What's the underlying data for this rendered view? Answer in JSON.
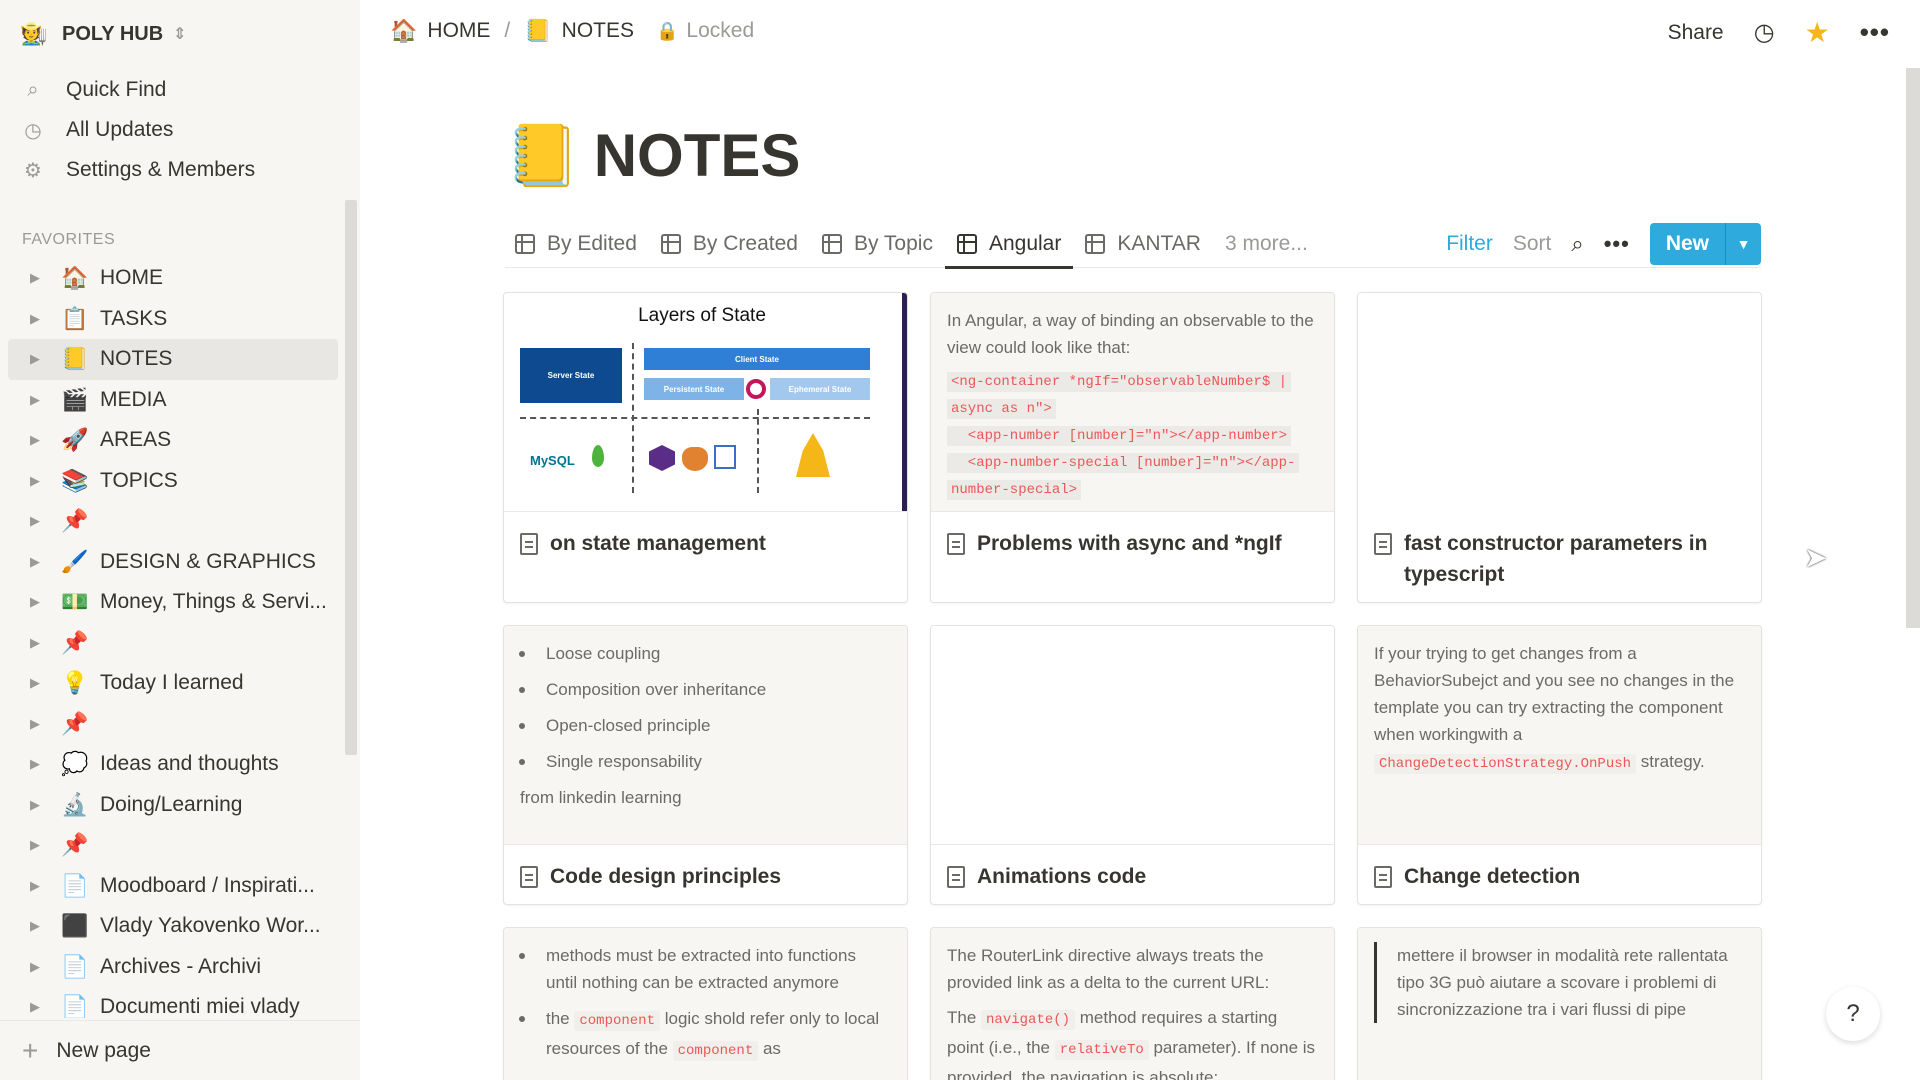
{
  "sidebar": {
    "workspace": {
      "emoji": "🧑‍🌾",
      "name": "POLY HUB"
    },
    "nav": [
      {
        "icon": "search-icon",
        "glyph": "⚲",
        "label": "Quick Find"
      },
      {
        "icon": "clock-icon",
        "glyph": "◷",
        "label": "All Updates"
      },
      {
        "icon": "gear-icon",
        "glyph": "⚙",
        "label": "Settings & Members"
      }
    ],
    "favorites_label": "FAVORITES",
    "favorites": [
      {
        "emoji": "🏠",
        "label": "HOME"
      },
      {
        "emoji": "📋",
        "label": "TASKS"
      },
      {
        "emoji": "📒",
        "label": "NOTES"
      },
      {
        "emoji": "🎬",
        "label": "MEDIA"
      },
      {
        "emoji": "🚀",
        "label": "AREAS"
      },
      {
        "emoji": "📚",
        "label": "TOPICS"
      },
      {
        "emoji": "📌",
        "label": ""
      },
      {
        "emoji": "🖌️",
        "label": "DESIGN & GRAPHICS"
      },
      {
        "emoji": "💵",
        "label": "Money, Things & Servi..."
      },
      {
        "emoji": "📌",
        "label": ""
      },
      {
        "emoji": "💡",
        "label": "Today I learned"
      },
      {
        "emoji": "📌",
        "label": ""
      },
      {
        "emoji": "💭",
        "label": "Ideas and thoughts"
      },
      {
        "emoji": "🔬",
        "label": "Doing/Learning"
      },
      {
        "emoji": "📌",
        "label": ""
      },
      {
        "emoji": "📄",
        "label": "Moodboard / Inspirati..."
      },
      {
        "emoji": "⬛",
        "label": "Vlady Yakovenko Wor..."
      },
      {
        "emoji": "📄",
        "label": "Archives - Archivi"
      },
      {
        "emoji": "📄",
        "label": "Documenti miei vlady"
      }
    ],
    "new_page": "New page"
  },
  "topbar": {
    "crumb_home_emoji": "🏠",
    "crumb_home": "HOME",
    "crumb_sep": "/",
    "crumb_notes_emoji": "📒",
    "crumb_notes": "NOTES",
    "locked": "Locked",
    "share": "Share"
  },
  "page": {
    "emoji": "📒",
    "title": "NOTES"
  },
  "views": {
    "tabs": [
      {
        "label": "By Edited"
      },
      {
        "label": "By Created"
      },
      {
        "label": "By Topic"
      },
      {
        "label": "Angular"
      },
      {
        "label": "KANTAR"
      }
    ],
    "more": "3 more...",
    "filter": "Filter",
    "sort": "Sort",
    "new": "New"
  },
  "cards": {
    "c1": {
      "title": "on state management",
      "diagram": {
        "title": "Layers of  State",
        "server": "Server State",
        "client": "Client State",
        "persistent": "Persistent State",
        "ephemeral": "Ephemeral State",
        "mysql": "MySQL"
      }
    },
    "c2": {
      "title": "Problems with async and *ngIf",
      "intro": "In Angular, a way of binding an observable to the view could look like that:",
      "code1": "<ng-container *ngIf=\"observableNumber$ |",
      "code2": "async as n\">",
      "code3": "  <app-number [number]=\"n\"></app-number>",
      "code4": "  <app-number-special [number]=\"n\"></app-",
      "code5": "number-special>"
    },
    "c3": {
      "title": "fast constructor parameters in typescript"
    },
    "c4": {
      "title": "Code design principles",
      "bullets": [
        "Loose coupling",
        "Composition over inheritance",
        "Open-closed principle",
        "Single responsability"
      ],
      "footer": "from linkedin learning"
    },
    "c5": {
      "title": "Animations code"
    },
    "c6": {
      "title": "Change detection",
      "text": "If your trying to get changes from a BehaviorSubejct and you see no changes in the template you can try extracting the component when workingwith a ",
      "code": "ChangeDetectionStrategy.OnPush",
      "after": " strategy."
    },
    "c7": {
      "b1": "methods must be extracted into functions until nothing can be extracted anymore",
      "b2a": "the ",
      "b2code": "component",
      "b2b": " logic shold refer only to local resources of the ",
      "b2code2": "component",
      "b2c": " as"
    },
    "c8": {
      "p1": "The RouterLink directive always treats the provided link as a delta to the current URL:",
      "p2a": "The ",
      "p2code": "navigate()",
      "p2b": " method requires a starting point (i.e., the ",
      "p2code2": "relativeTo",
      "p2c": " parameter). If none is provided, the navigation is absolute:"
    },
    "c9": {
      "quote": "mettere il browser in modalità rete rallentata tipo 3G può aiutare a scovare i problemi di sincronizzazione tra i vari flussi di pipe"
    }
  },
  "help": "?",
  "colors": {
    "accent": "#2eaadc",
    "star": "#f5b618",
    "code": "#eb5757"
  }
}
